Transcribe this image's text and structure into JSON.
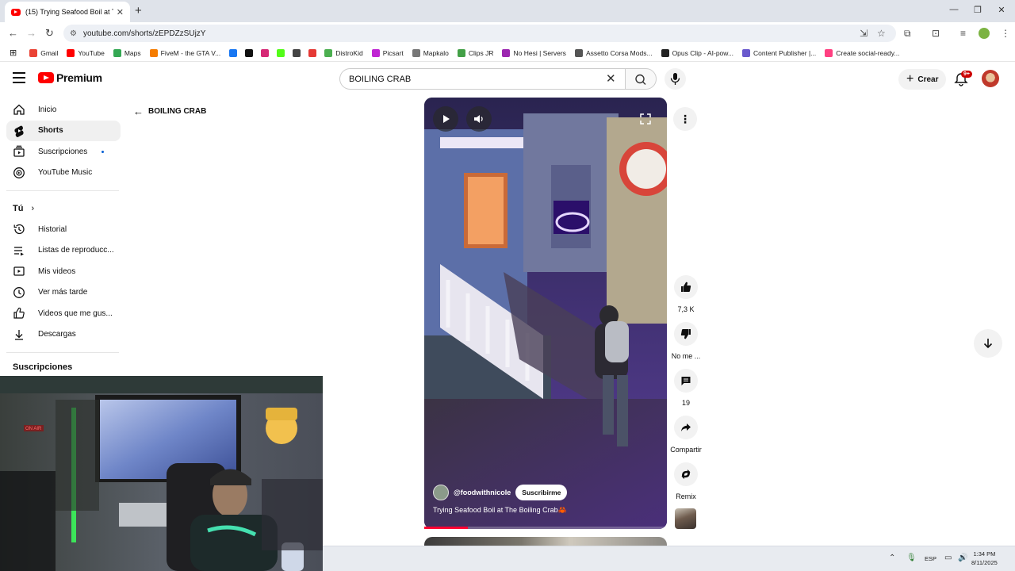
{
  "browser": {
    "tab_title": "(15) Trying Seafood Boil at The Boiling Crab",
    "url": "youtube.com/shorts/zEPDZzSUjzY",
    "bookmarks": [
      {
        "label": "Gmail",
        "color": "#ea4335"
      },
      {
        "label": "YouTube",
        "color": "#ff0000"
      },
      {
        "label": "Maps",
        "color": "#34a853"
      },
      {
        "label": "FiveM - the GTA V...",
        "color": "#f57c00"
      },
      {
        "label": "",
        "color": "#1877f2"
      },
      {
        "label": "",
        "color": "#111111"
      },
      {
        "label": "",
        "color": "#d62976"
      },
      {
        "label": "",
        "color": "#53fc18"
      },
      {
        "label": "",
        "color": "#444444"
      },
      {
        "label": "",
        "color": "#e53935"
      },
      {
        "label": "DistroKid",
        "color": "#4caf50"
      },
      {
        "label": "Picsart",
        "color": "#c026d3"
      },
      {
        "label": "Mapkalo",
        "color": "#777777"
      },
      {
        "label": "Clips JR",
        "color": "#43a047"
      },
      {
        "label": "No Hesi | Servers",
        "color": "#9c27b0"
      },
      {
        "label": "Assetto Corsa Mods...",
        "color": "#555555"
      },
      {
        "label": "Opus Clip - AI-pow...",
        "color": "#222222"
      },
      {
        "label": "Content Publisher |...",
        "color": "#6a5acd"
      },
      {
        "label": "Create social-ready...",
        "color": "#ff4081"
      }
    ]
  },
  "header": {
    "logo_text": "Premium",
    "search_value": "BOILING CRAB",
    "create_label": "Crear",
    "notification_badge": "9+"
  },
  "sidebar": {
    "main": [
      {
        "label": "Inicio",
        "icon": "home-icon",
        "active": false
      },
      {
        "label": "Shorts",
        "icon": "shorts-icon",
        "active": true
      },
      {
        "label": "Suscripciones",
        "icon": "subscriptions-icon",
        "active": false
      },
      {
        "label": "YouTube Music",
        "icon": "music-icon",
        "active": false
      }
    ],
    "you_heading": "Tú",
    "you": [
      {
        "label": "Historial",
        "icon": "history-icon"
      },
      {
        "label": "Listas de reproducc...",
        "icon": "playlists-icon"
      },
      {
        "label": "Mis videos",
        "icon": "my-videos-icon"
      },
      {
        "label": "Ver más tarde",
        "icon": "watch-later-icon"
      },
      {
        "label": "Videos que me gus...",
        "icon": "liked-icon"
      },
      {
        "label": "Descargas",
        "icon": "downloads-icon"
      }
    ],
    "subscriptions_heading": "Suscripciones"
  },
  "back_label": "BOILING CRAB",
  "short": {
    "channel_handle": "@foodwithnicole",
    "subscribe_label": "Suscribirme",
    "caption": "Trying Seafood Boil at The Boiling Crab🦀",
    "progress_fraction": 0.18,
    "likes": "7,3 K",
    "dislike_label": "No me ...",
    "comments": "19",
    "share_label": "Compartir",
    "remix_label": "Remix"
  },
  "taskbar": {
    "language": "ESP",
    "time": "1:34 PM",
    "date": "8/11/2025"
  }
}
